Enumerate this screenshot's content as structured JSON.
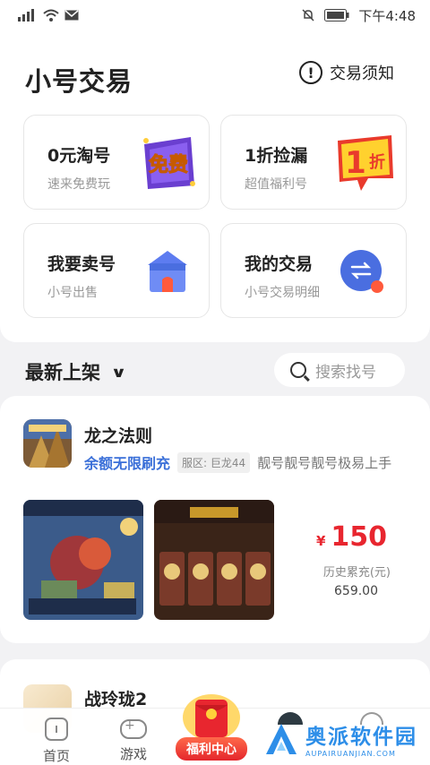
{
  "status_bar": {
    "time": "下午4:48",
    "icons": [
      "signal-icon",
      "wifi-icon",
      "mail-icon",
      "mute-icon",
      "battery-icon"
    ]
  },
  "header": {
    "title": "小号交易",
    "notice_label": "交易须知"
  },
  "cards": [
    {
      "title": "0元淘号",
      "subtitle": "速来免费玩",
      "art": "免费",
      "icon": "free-badge-icon"
    },
    {
      "title": "1折捡漏",
      "subtitle": "超值福利号",
      "art_num": "1",
      "art_char": "折",
      "icon": "discount-badge-icon"
    },
    {
      "title": "我要卖号",
      "subtitle": "小号出售",
      "icon": "shop-icon"
    },
    {
      "title": "我的交易",
      "subtitle": "小号交易明细",
      "icon": "exchange-icon"
    }
  ],
  "section": {
    "title": "最新上架",
    "search_placeholder": "搜索找号"
  },
  "listings": [
    {
      "game": "龙之法则",
      "highlight": "余额无限刷充",
      "server": "服区: 巨龙44",
      "description": "靓号靓号靓号极易上手",
      "currency": "¥",
      "price": "150",
      "history_label": "历史累充(元)",
      "history_value": "659.00"
    },
    {
      "game": "战玲珑2"
    }
  ],
  "tabbar": {
    "home": "首页",
    "games": "游戏",
    "benefit": "福利中心"
  },
  "colors": {
    "accent_blue": "#3a6fd8",
    "price_red": "#e8262f",
    "trade_blue": "#4a6ee0"
  }
}
